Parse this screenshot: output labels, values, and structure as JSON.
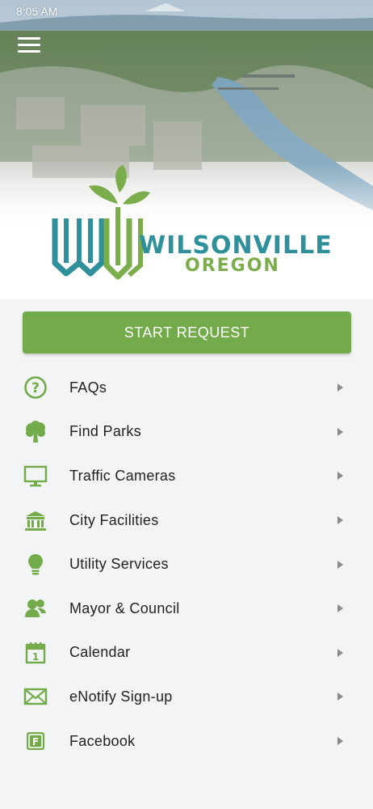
{
  "status_bar": {
    "time": "8:05 AM"
  },
  "header": {
    "menu_icon": "hamburger-icon",
    "logo": {
      "title": "WILSONVILLE",
      "subtitle": "OREGON"
    }
  },
  "colors": {
    "accent": "#73ab4b",
    "brand_teal": "#2f8f9a",
    "brand_green": "#7cad4d"
  },
  "start_request": {
    "label": "START REQUEST"
  },
  "menu": [
    {
      "label": "FAQs",
      "icon": "question-circle-icon"
    },
    {
      "label": "Find Parks",
      "icon": "tree-icon"
    },
    {
      "label": "Traffic Cameras",
      "icon": "monitor-icon"
    },
    {
      "label": "City Facilities",
      "icon": "building-icon"
    },
    {
      "label": "Utility Services",
      "icon": "lightbulb-icon"
    },
    {
      "label": "Mayor & Council",
      "icon": "people-icon"
    },
    {
      "label": "Calendar",
      "icon": "calendar-icon"
    },
    {
      "label": "eNotify Sign-up",
      "icon": "envelope-icon"
    },
    {
      "label": "Facebook",
      "icon": "facebook-icon"
    }
  ]
}
